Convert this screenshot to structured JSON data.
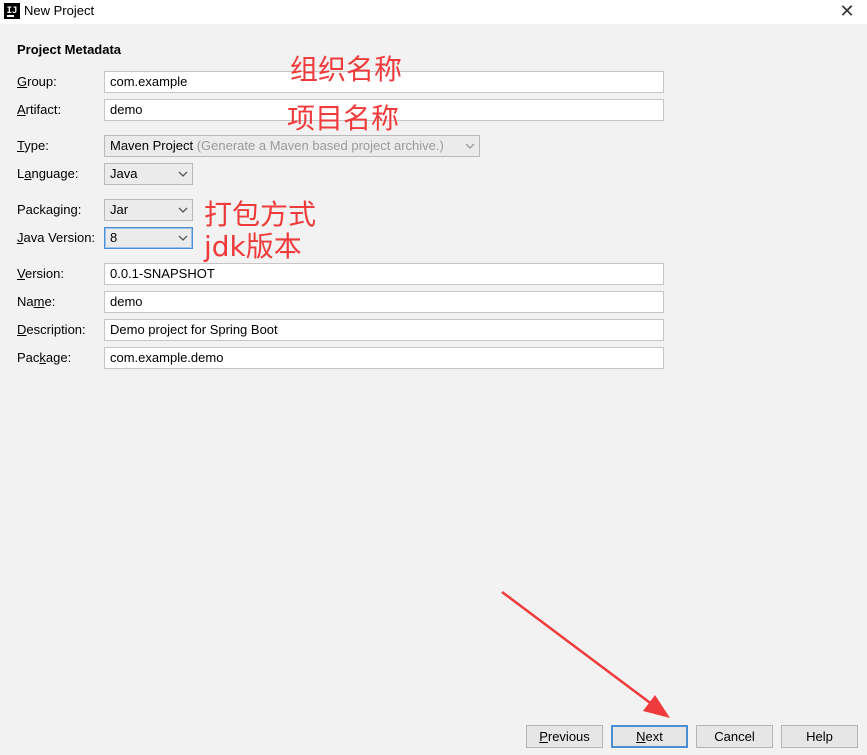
{
  "window": {
    "title": "New Project",
    "icon": "intellij-idea-icon",
    "close_glyph": "✕"
  },
  "section_title": "Project Metadata",
  "fields": {
    "group": {
      "label_mn": "G",
      "label_rest": "roup:",
      "value": "com.example"
    },
    "artifact": {
      "label_mn": "A",
      "label_rest": "rtifact:",
      "value": "demo"
    },
    "type": {
      "label_mn": "T",
      "label_rest": "ype:",
      "value": "Maven Project",
      "hint": "(Generate a Maven based project archive.)"
    },
    "language": {
      "label_pre": "L",
      "label_mn": "a",
      "label_rest": "nguage:",
      "value": "Java"
    },
    "packaging": {
      "label_pre": "Packa",
      "label_mn": "g",
      "label_rest": "ing:",
      "value": "Jar"
    },
    "java_version": {
      "label_pre": "",
      "label_mn": "J",
      "label_rest": "ava Version:",
      "value": "8"
    },
    "version": {
      "label_mn": "V",
      "label_rest": "ersion:",
      "value": "0.0.1-SNAPSHOT"
    },
    "name": {
      "label_pre": "Na",
      "label_mn": "m",
      "label_rest": "e:",
      "value": "demo"
    },
    "description": {
      "label_mn": "D",
      "label_rest": "escription:",
      "value": "Demo project for Spring Boot"
    },
    "package": {
      "label_pre": "Pac",
      "label_mn": "k",
      "label_rest": "age:",
      "value": "com.example.demo"
    }
  },
  "annotations": {
    "group": "组织名称",
    "artifact": "项目名称",
    "packaging": "打包方式",
    "java_version": "jdk版本"
  },
  "buttons": {
    "previous": {
      "mn": "P",
      "rest": "revious"
    },
    "next": {
      "mn": "N",
      "rest": "ext"
    },
    "cancel": "Cancel",
    "help": "Help"
  },
  "colors": {
    "annotation": "#ef3b3b",
    "focus": "#4a90d9"
  }
}
